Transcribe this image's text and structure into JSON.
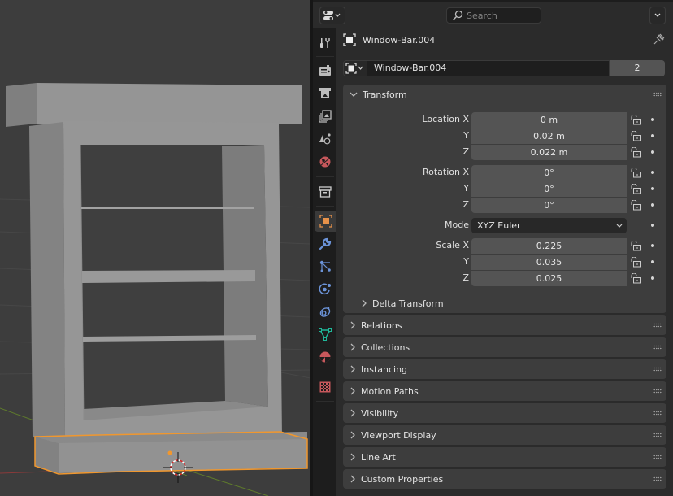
{
  "header": {
    "search_placeholder": "Search"
  },
  "tabs": [
    {
      "name": "tool",
      "icon": "tool-icon"
    },
    {
      "name": "render",
      "icon": "render-icon"
    },
    {
      "name": "output",
      "icon": "output-icon"
    },
    {
      "name": "view-layer",
      "icon": "view-layer-icon"
    },
    {
      "name": "scene",
      "icon": "scene-icon"
    },
    {
      "name": "world",
      "icon": "world-icon"
    },
    {
      "name": "collection",
      "icon": "collection-icon"
    },
    {
      "name": "object",
      "icon": "object-icon",
      "active": true
    },
    {
      "name": "modifiers",
      "icon": "wrench-icon"
    },
    {
      "name": "particles",
      "icon": "particles-icon"
    },
    {
      "name": "physics",
      "icon": "physics-icon"
    },
    {
      "name": "constraints",
      "icon": "constraints-icon"
    },
    {
      "name": "data",
      "icon": "mesh-data-icon"
    },
    {
      "name": "material",
      "icon": "material-icon"
    },
    {
      "name": "texture",
      "icon": "texture-icon"
    }
  ],
  "context": {
    "object_name": "Window-Bar.004"
  },
  "datablock": {
    "name": "Window-Bar.004",
    "users": "2"
  },
  "transform": {
    "title": "Transform",
    "location": {
      "label": "Location X",
      "y_label": "Y",
      "z_label": "Z",
      "x": "0 m",
      "y": "0.02 m",
      "z": "0.022 m"
    },
    "rotation": {
      "label": "Rotation X",
      "y_label": "Y",
      "z_label": "Z",
      "x": "0°",
      "y": "0°",
      "z": "0°"
    },
    "mode": {
      "label": "Mode",
      "value": "XYZ Euler"
    },
    "scale": {
      "label": "Scale X",
      "y_label": "Y",
      "z_label": "Z",
      "x": "0.225",
      "y": "0.035",
      "z": "0.025"
    },
    "delta": "Delta Transform"
  },
  "panels": [
    "Relations",
    "Collections",
    "Instancing",
    "Motion Paths",
    "Visibility",
    "Viewport Display",
    "Line Art",
    "Custom Properties"
  ],
  "colors": {
    "selection_outline": "#f0972e",
    "object_tab_icon": "#e8924a",
    "modifier_icon": "#6b93d8",
    "mesh_icon": "#1fb89a",
    "material_icon": "#c7585c"
  }
}
